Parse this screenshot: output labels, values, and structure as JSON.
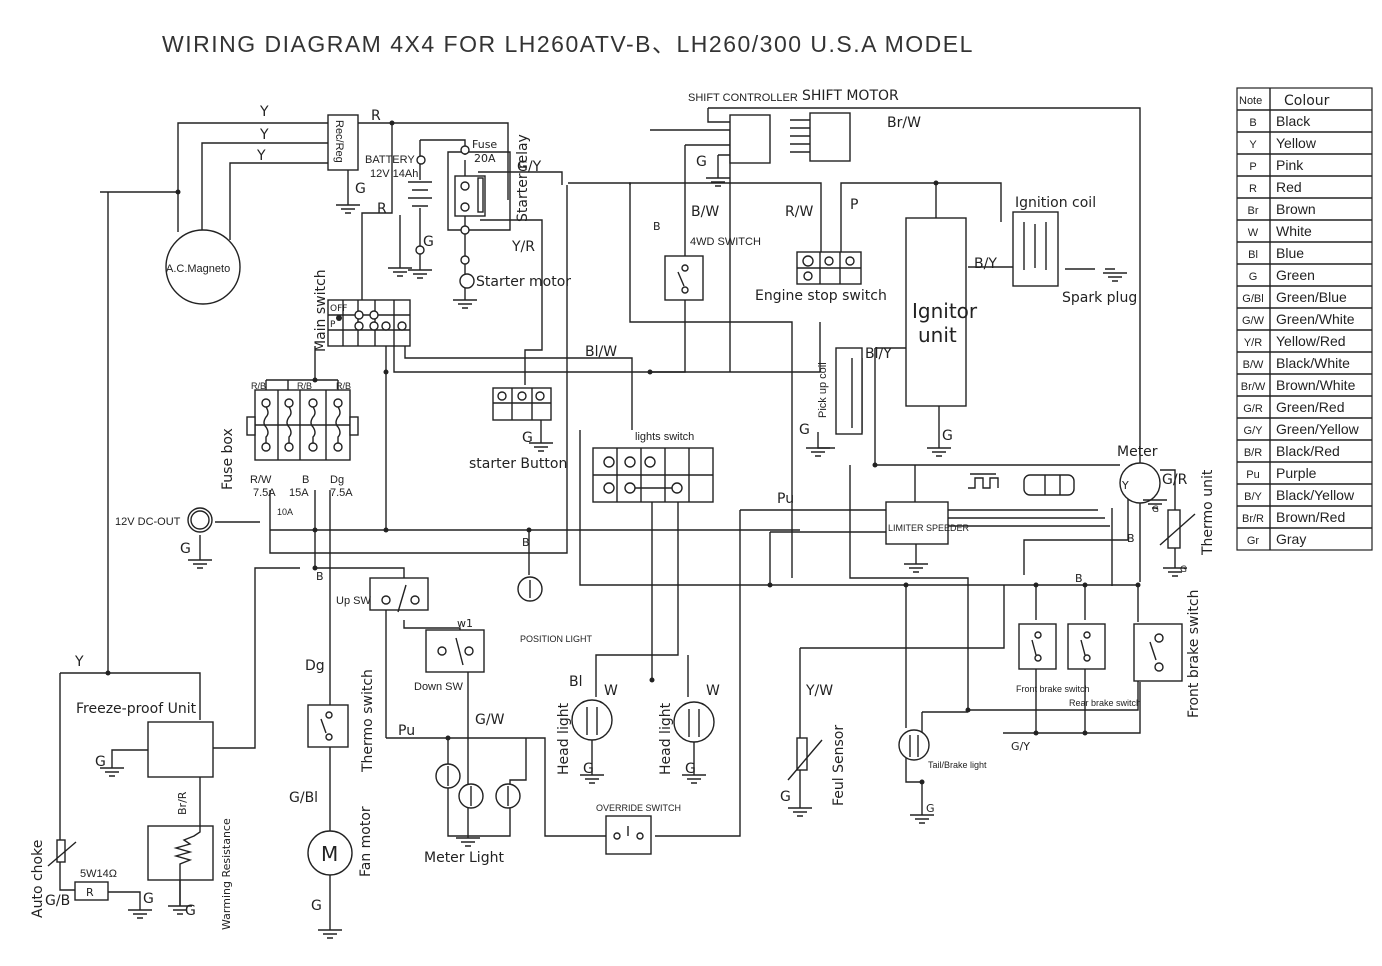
{
  "title": "WIRING DIAGRAM 4X4 FOR LH260ATV-B、LH260/300   U.S.A MODEL",
  "legend": {
    "header_note": "Note",
    "header_colour": "Colour",
    "rows": [
      {
        "note": "B",
        "colour": "Black"
      },
      {
        "note": "Y",
        "colour": "Yellow"
      },
      {
        "note": "P",
        "colour": "Pink"
      },
      {
        "note": "R",
        "colour": "Red"
      },
      {
        "note": "Br",
        "colour": "Brown"
      },
      {
        "note": "W",
        "colour": "White"
      },
      {
        "note": "Bl",
        "colour": "Blue"
      },
      {
        "note": "G",
        "colour": "Green"
      },
      {
        "note": "G/Bl",
        "colour": "Green/Blue"
      },
      {
        "note": "G/W",
        "colour": "Green/White"
      },
      {
        "note": "Y/R",
        "colour": "Yellow/Red"
      },
      {
        "note": "B/W",
        "colour": "Black/White"
      },
      {
        "note": "Br/W",
        "colour": "Brown/White"
      },
      {
        "note": "G/R",
        "colour": "Green/Red"
      },
      {
        "note": "G/Y",
        "colour": "Green/Yellow"
      },
      {
        "note": "B/R",
        "colour": "Black/Red"
      },
      {
        "note": "Pu",
        "colour": "Purple"
      },
      {
        "note": "B/Y",
        "colour": "Black/Yellow"
      },
      {
        "note": "Br/R",
        "colour": "Brown/Red"
      },
      {
        "note": "Gr",
        "colour": "Gray"
      }
    ]
  },
  "components": {
    "ac_magneto": "A.C.Magneto",
    "rec_reg": "Rec/Reg",
    "battery": "BATTERY",
    "battery_spec": "12V 14Ah",
    "fuse": "Fuse",
    "fuse_rating": "20A",
    "starter_relay": "Starter relay",
    "starter_motor": "Starter motor",
    "main_switch": "Main switch",
    "main_switch_off": "OFF",
    "main_switch_p": "P",
    "fuse_box": "Fuse box",
    "dc_out": "12V DC-OUT",
    "starter_button": "starter Button",
    "shift_controller": "SHIFT CONTROLLER",
    "shift_motor": "SHIFT MOTOR",
    "switch_4wd": "4WD SWITCH",
    "engine_stop_switch": "Engine stop switch",
    "ignitor_unit_line1": "Ignitor",
    "ignitor_unit_line2": "unit",
    "ignition_coil": "Ignition coil",
    "spark_plug": "Spark plug",
    "pick_up_coil": "Pick up coil",
    "lights_switch": "lights switch",
    "limiter_speeder": "LIMITER SPEEDER",
    "meter": "Meter",
    "thermo_unit": "Thermo unit",
    "up_sw": "Up SW",
    "down_sw": "Down SW",
    "w1": "w1",
    "position_light": "POSITION LIGHT",
    "head_light": "Head light",
    "front_brake_switch_small": "Front brake switch",
    "rear_brake_switch": "Rear brake switch",
    "front_brake_switch": "Front brake switch",
    "freeze_proof_unit": "Freeze-proof Unit",
    "warming_resistance": "Warming Resistance",
    "auto_choke": "Auto choke",
    "resistor_spec": "5W14Ω",
    "resistor": "R",
    "thermo_switch": "Thermo switch",
    "fan_motor": "Fan motor",
    "fan_motor_symbol": "M",
    "meter_light": "Meter Light",
    "override_switch": "OVERRIDE SWITCH",
    "feul_sensor": "Feul Sensor",
    "tail_brake_light": "Tail/Brake light",
    "meter_y": "Y"
  },
  "fuses": {
    "f1": {
      "wire": "R/W",
      "rating": "7.5A"
    },
    "f2": {
      "rating": "10A"
    },
    "f3": {
      "wire": "B",
      "rating": "15A"
    },
    "f4": {
      "wire": "Dg",
      "rating": "7.5A"
    },
    "top_wires": [
      "R/B",
      "R/B",
      "R/B"
    ]
  },
  "wire_labels": {
    "y1": "Y",
    "y2": "Y",
    "y3": "Y",
    "y_left": "Y",
    "r_top": "R",
    "r_mid": "R",
    "g_recreg": "G",
    "g_batt": "G",
    "g_y_relay": "G/Y",
    "y_r": "Y/R",
    "br_w": "Br/W",
    "b_shift": "B",
    "b_w": "B/W",
    "r_w": "R/W",
    "p": "P",
    "b_y": "B/Y",
    "bl_y": "Bl/Y",
    "bl_w": "Bl/W",
    "g_shift": "G",
    "g_pickup": "G",
    "g_ignitor": "G",
    "g_starter": "G",
    "g_dcout": "G",
    "pu_top": "Pu",
    "pu_bottom": "Pu",
    "g_r": "G/R",
    "g_meter": "G",
    "g_thermo": "G",
    "b_meter": "B",
    "b_brake": "B",
    "b_bus": "B",
    "b_upsw": "B",
    "dg": "Dg",
    "g_bl": "G/Bl",
    "g_fan": "G",
    "g_w": "G/W",
    "bl_head": "Bl",
    "w_head1": "W",
    "w_head2": "W",
    "g_head1": "G",
    "g_head2": "G",
    "y_w": "Y/W",
    "g_feul": "G",
    "g_tail": "G",
    "g_y_brake": "G/Y",
    "g_freeze": "G",
    "br_r": "Br/R",
    "g_b": "G/B",
    "g_res": "G",
    "g_warm": "G"
  }
}
